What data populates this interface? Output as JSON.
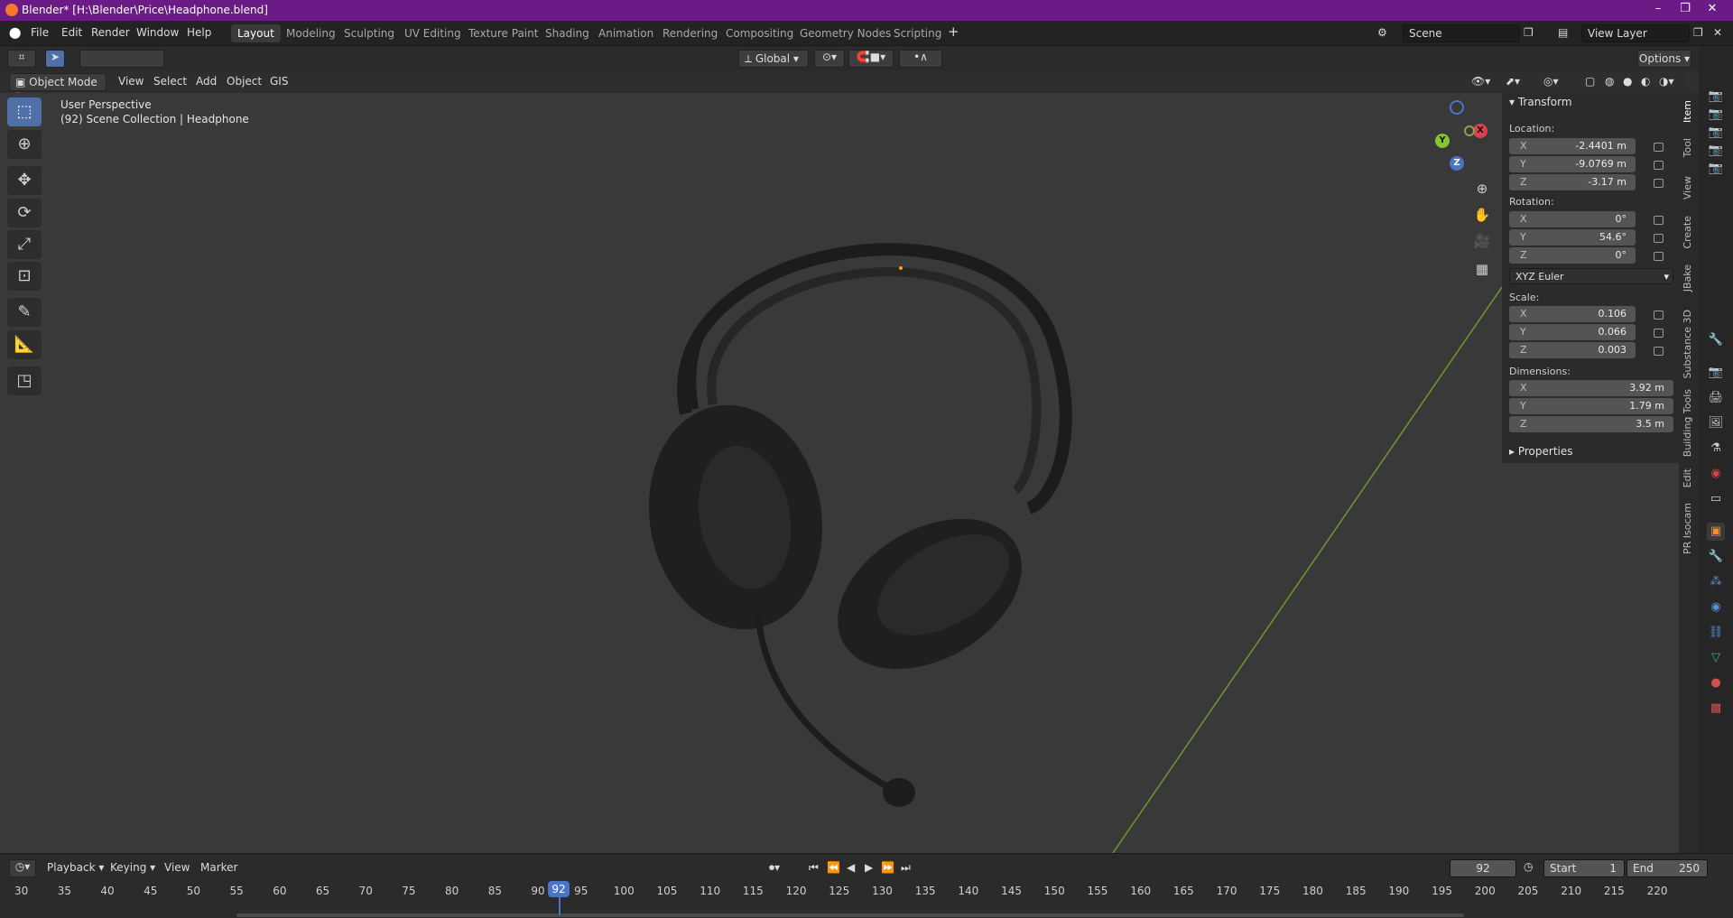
{
  "window": {
    "title": "Blender* [H:\\Blender\\Price\\Headphone.blend]"
  },
  "menu": [
    "File",
    "Edit",
    "Render",
    "Window",
    "Help"
  ],
  "workspaces": [
    "Layout",
    "Modeling",
    "Sculpting",
    "UV Editing",
    "Texture Paint",
    "Shading",
    "Animation",
    "Rendering",
    "Compositing",
    "Geometry Nodes",
    "Scripting"
  ],
  "active_workspace": "Layout",
  "scene": {
    "name": "Scene",
    "view_layer": "View Layer"
  },
  "toolbar": {
    "transform_orientation": "Global",
    "options_label": "Options"
  },
  "header": {
    "mode": "Object Mode",
    "items": [
      "View",
      "Select",
      "Add",
      "Object",
      "GIS"
    ]
  },
  "viewport": {
    "perspective": "User Perspective",
    "collection_info": "(92) Scene Collection | Headphone"
  },
  "gizmo": {
    "x": "X",
    "y": "Y",
    "z": "Z"
  },
  "npanel": {
    "transform_title": "Transform",
    "location_label": "Location:",
    "location": [
      {
        "axis": "X",
        "value": "-2.4401 m"
      },
      {
        "axis": "Y",
        "value": "-9.0769 m"
      },
      {
        "axis": "Z",
        "value": "-3.17 m"
      }
    ],
    "rotation_label": "Rotation:",
    "rotation": [
      {
        "axis": "X",
        "value": "0°"
      },
      {
        "axis": "Y",
        "value": "54.6°"
      },
      {
        "axis": "Z",
        "value": "0°"
      }
    ],
    "rotation_mode": "XYZ Euler",
    "scale_label": "Scale:",
    "scale": [
      {
        "axis": "X",
        "value": "0.106"
      },
      {
        "axis": "Y",
        "value": "0.066"
      },
      {
        "axis": "Z",
        "value": "0.003"
      }
    ],
    "dimensions_label": "Dimensions:",
    "dimensions": [
      {
        "axis": "X",
        "value": "3.92 m"
      },
      {
        "axis": "Y",
        "value": "1.79 m"
      },
      {
        "axis": "Z",
        "value": "3.5 m"
      }
    ],
    "properties_title": "Properties"
  },
  "side_tabs": [
    "Item",
    "Tool",
    "View",
    "Create",
    "JBake",
    "Substance 3D",
    "Building Tools",
    "Edit",
    "PR Isocam"
  ],
  "timeline": {
    "menus": [
      "Playback",
      "Keying",
      "View",
      "Marker"
    ],
    "current_frame": "92",
    "start_label": "Start",
    "start": "1",
    "end_label": "End",
    "end": "250",
    "ticks": [
      "30",
      "35",
      "40",
      "45",
      "50",
      "55",
      "60",
      "65",
      "70",
      "75",
      "80",
      "85",
      "90",
      "95",
      "100",
      "105",
      "110",
      "115",
      "120",
      "125",
      "130",
      "135",
      "140",
      "145",
      "150",
      "155",
      "160",
      "165",
      "170",
      "175",
      "180",
      "185",
      "190",
      "195",
      "200",
      "205",
      "210",
      "215",
      "220"
    ]
  }
}
